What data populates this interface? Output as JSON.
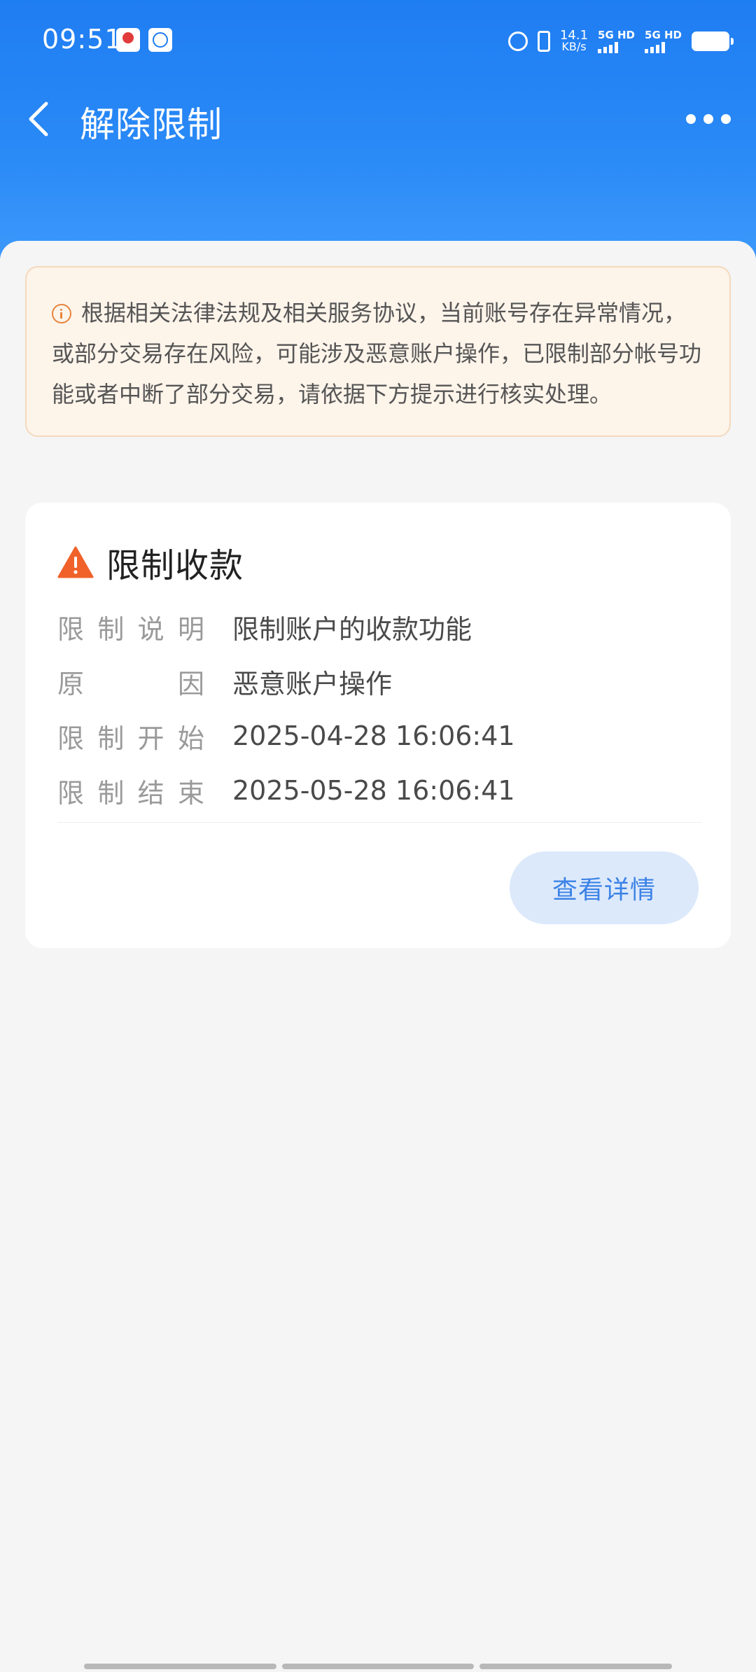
{
  "status_bar": {
    "time": "09:51",
    "net_speed_value": "14.1",
    "net_speed_unit": "KB/s",
    "signal1_label": "5G HD",
    "signal2_label": "5G HD",
    "icons": [
      "app-notification-icon",
      "app-notification-icon",
      "alarm-icon",
      "vibrate-icon",
      "signal-icon",
      "battery-icon"
    ]
  },
  "nav": {
    "title": "解除限制",
    "back_icon": "chevron-left-icon",
    "more_icon": "more-dots-icon"
  },
  "notice": {
    "icon": "info-circle-icon",
    "text": "根据相关法律法规及相关服务协议，当前账号存在异常情况，或部分交易存在风险，可能涉及恶意账户操作，已限制部分帐号功能或者中断了部分交易，请依据下方提示进行核实处理。"
  },
  "restriction_card": {
    "icon": "warning-triangle-icon",
    "title": "限制收款",
    "rows": [
      {
        "label": [
          "限",
          "制",
          "说",
          "明"
        ],
        "value": "限制账户的收款功能"
      },
      {
        "label": [
          "原",
          "因"
        ],
        "value": "恶意账户操作"
      },
      {
        "label": [
          "限",
          "制",
          "开",
          "始"
        ],
        "value": "2025-04-28 16:06:41"
      },
      {
        "label": [
          "限",
          "制",
          "结",
          "束"
        ],
        "value": "2025-05-28 16:06:41"
      }
    ],
    "detail_button": "查看详情"
  },
  "colors": {
    "header_blue": "#1f7df2",
    "notice_bg": "#fdf4ea",
    "warning_orange": "#f0622a",
    "button_text_blue": "#3b82e6",
    "button_bg": "#dce9fb"
  }
}
